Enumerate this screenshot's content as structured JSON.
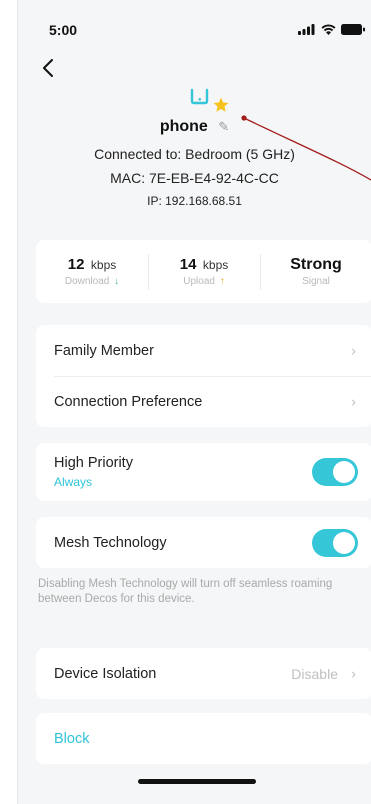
{
  "status_bar": {
    "time": "5:00"
  },
  "device": {
    "name": "phone",
    "connected_to": "Connected to: Bedroom (5 GHz)",
    "mac": "MAC: 7E-EB-E4-92-4C-CC",
    "ip": "IP: 192.168.68.51"
  },
  "stats": {
    "download": {
      "value": "12",
      "unit": "kbps",
      "label": "Download"
    },
    "upload": {
      "value": "14",
      "unit": "kbps",
      "label": "Upload"
    },
    "signal": {
      "value": "Strong",
      "label": "Signal"
    }
  },
  "menu": {
    "family_member": "Family Member",
    "connection_preference": "Connection Preference"
  },
  "high_priority": {
    "title": "High Priority",
    "subtitle": "Always",
    "enabled": true
  },
  "mesh": {
    "title": "Mesh Technology",
    "enabled": true,
    "note": "Disabling Mesh Technology will turn off seamless roaming between Decos for this device."
  },
  "isolation": {
    "title": "Device Isolation",
    "value": "Disable"
  },
  "block": {
    "label": "Block"
  },
  "colors": {
    "accent": "#35c6d8",
    "star": "#f6c21c",
    "download_arrow": "#3fc28b",
    "upload_arrow": "#f5a623",
    "annotation": "#a31c1c"
  }
}
